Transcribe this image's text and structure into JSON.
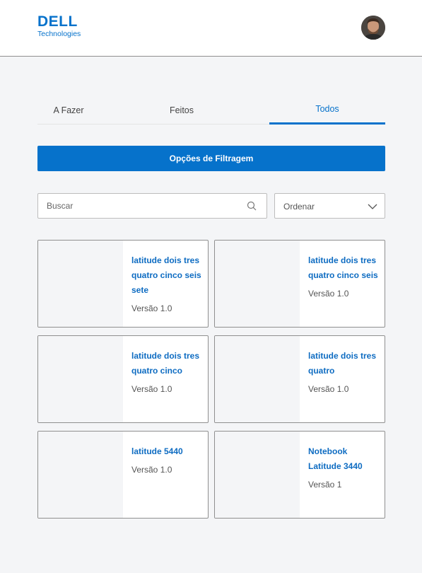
{
  "header": {
    "brand_name": "DELL",
    "brand_sub": "Technologies",
    "avatar_icon": "user-avatar",
    "accent": "#0672cb"
  },
  "tabs": [
    {
      "label": "A Fazer",
      "active": false
    },
    {
      "label": "Feitos",
      "active": false
    },
    {
      "label": "Todos",
      "active": true
    }
  ],
  "filter_button": {
    "label": "Opções de Filtragem"
  },
  "search": {
    "placeholder": "Buscar",
    "value": "",
    "icon": "search-icon"
  },
  "sort": {
    "label": "Ordenar",
    "icon": "chevron-down-icon"
  },
  "cards": [
    {
      "title": "latitude dois tres quatro cinco seis sete",
      "version": "Versão 1.0"
    },
    {
      "title": "latitude dois tres quatro cinco seis",
      "version": "Versão 1.0"
    },
    {
      "title": "latitude dois tres quatro cinco",
      "version": "Versão 1.0"
    },
    {
      "title": "latitude dois tres quatro",
      "version": "Versão 1.0"
    },
    {
      "title": "latitude 5440",
      "version": "Versão 1.0"
    },
    {
      "title": "Notebook Latitude 3440",
      "version": "Versão 1"
    }
  ]
}
